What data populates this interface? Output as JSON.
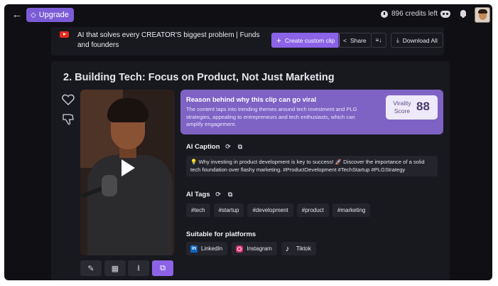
{
  "topbar": {
    "back_icon": "arrow-left-icon",
    "upgrade_label": "Upgrade",
    "credits_text": "896 credits left"
  },
  "video": {
    "title": "AI that solves every CREATOR'S biggest problem | Funds and founders",
    "create_label": "Create custom clip",
    "share_label": "Share",
    "download_label": "Download All"
  },
  "clip": {
    "title": "2. Building Tech: Focus on Product, Not Just Marketing",
    "viral_heading": "Reason behind why this clip can go viral",
    "viral_text": "The content taps into trending themes around tech investment and PLG strategies, appealing to entrepreneurs and tech enthusiasts, which can amplify engagement.",
    "score_label": "Virality Score",
    "score_value": "88",
    "caption_heading": "AI Caption",
    "caption_text": "💡 Why investing in product development is key to success! 🚀 Discover the importance of a solid tech foundation over flashy marketing. #ProductDevelopment #TechStartup #PLGStrategy",
    "tags_heading": "AI Tags",
    "tags": [
      "#tech",
      "#startup",
      "#development",
      "#product",
      "#marketing"
    ],
    "platforms_heading": "Suitable for platforms",
    "platforms": [
      "LinkedIn",
      "Instagram",
      "Tiktok"
    ]
  },
  "colors": {
    "accent": "#8b63e6",
    "viral_bg": "#7e63c5",
    "background": "#0f0f14",
    "card": "#18181f"
  }
}
